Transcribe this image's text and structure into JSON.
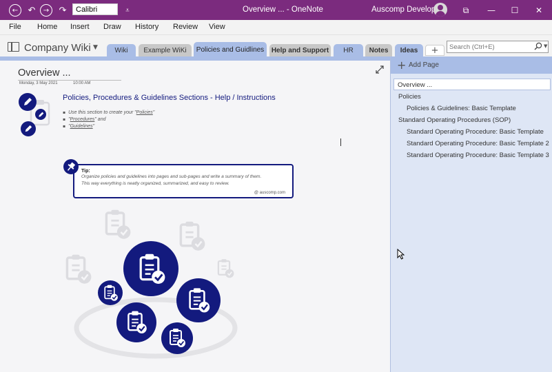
{
  "titlebar": {
    "font_value": "Calibri",
    "title": "Overview ...  -  OneNote",
    "user": "Auscomp Developer"
  },
  "menu": [
    "File",
    "Home",
    "Insert",
    "Draw",
    "History",
    "Review",
    "View"
  ],
  "notebook": {
    "name": "Company Wiki"
  },
  "tabs": [
    {
      "label": "Wiki",
      "color": "#a9bde6"
    },
    {
      "label": "Example WiKi",
      "color": "#c8c8c8"
    },
    {
      "label": "Policies and Guidlines",
      "color": "#a9bde6",
      "active": true
    },
    {
      "label": "Help and Support",
      "color": "#c8c8c8",
      "bold": true
    },
    {
      "label": "HR",
      "color": "#a9bde6"
    },
    {
      "label": "Notes",
      "color": "#c8c8c8",
      "bold": true
    },
    {
      "label": "Ideas",
      "color": "#a9bde6",
      "bold": true
    }
  ],
  "search": {
    "placeholder": "Search (Ctrl+E)"
  },
  "page": {
    "title": "Overview ...",
    "date": "Monday, 3 May 2021",
    "time": "10:00 AM",
    "heading": "Policies, Procedures & Guidelines Sections - Help / Instructions",
    "bullets": [
      {
        "pre": "Use this section to create your \"",
        "link": "Policies",
        "post": "\""
      },
      {
        "pre": "\"",
        "link": "Procedures",
        "post": "\" and"
      },
      {
        "pre": "\"",
        "link": "Guidelines",
        "post": "\""
      }
    ],
    "tip": {
      "title": "Tip:",
      "line1": "Organize policies and guidelines into pages and sub-pages and write a summary of them.",
      "line2": "This way everything is neatly organized, summarized, and easy to review.",
      "credit": "@ auscomp.com"
    }
  },
  "pagelist": {
    "add_label": "Add Page",
    "items": [
      {
        "label": "Overview ...",
        "level": 0,
        "selected": true
      },
      {
        "label": "Policies",
        "level": 0
      },
      {
        "label": "Policies & Guidelines: Basic Template",
        "level": 1
      },
      {
        "label": "Standard Operating Procedures (SOP)",
        "level": 0
      },
      {
        "label": "Standard Operating Procedure: Basic Template",
        "level": 1
      },
      {
        "label": "Standard Operating Procedure: Basic Template 2",
        "level": 1
      },
      {
        "label": "Standard Operating Procedure: Basic Template 3",
        "level": 1
      }
    ]
  },
  "colors": {
    "brand": "#7b2b7e",
    "accent": "#131a7e",
    "section": "#a9bde6",
    "pane": "#dee6f5"
  }
}
